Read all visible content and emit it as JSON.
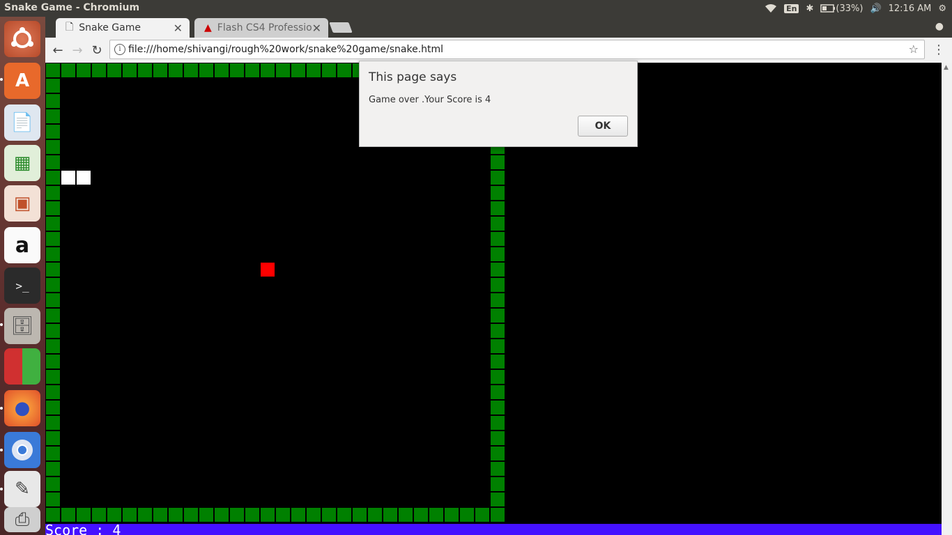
{
  "window": {
    "title": "Snake Game - Chromium"
  },
  "tray": {
    "keyboard": "En",
    "battery": "(33%)",
    "time": "12:16 AM"
  },
  "launcher": {
    "items": [
      "ubuntu-dash",
      "software-center",
      "libreoffice-writer",
      "libreoffice-calc",
      "libreoffice-impress",
      "amazon",
      "terminal",
      "files",
      "workspace-switcher",
      "firefox",
      "chromium",
      "text-editor",
      "printer"
    ]
  },
  "tabs": [
    {
      "label": "Snake Game",
      "active": true
    },
    {
      "label": "Flash CS4 Professio",
      "active": false
    }
  ],
  "omnibox": {
    "url": "file:///home/shivangi/rough%20work/snake%20game/snake.html"
  },
  "game": {
    "grid_cells": 30,
    "snake_cells": [
      [
        1,
        7
      ],
      [
        2,
        7
      ]
    ],
    "food_cell": [
      14,
      13
    ],
    "colors": {
      "wall": "#008000",
      "snake": "#ffffff",
      "food": "#ff0000",
      "score_bar": "#4411ff"
    }
  },
  "score": {
    "text": "Score : 4"
  },
  "alert": {
    "title": "This page says",
    "message": "Game over .Your Score is 4",
    "ok_label": "OK"
  }
}
